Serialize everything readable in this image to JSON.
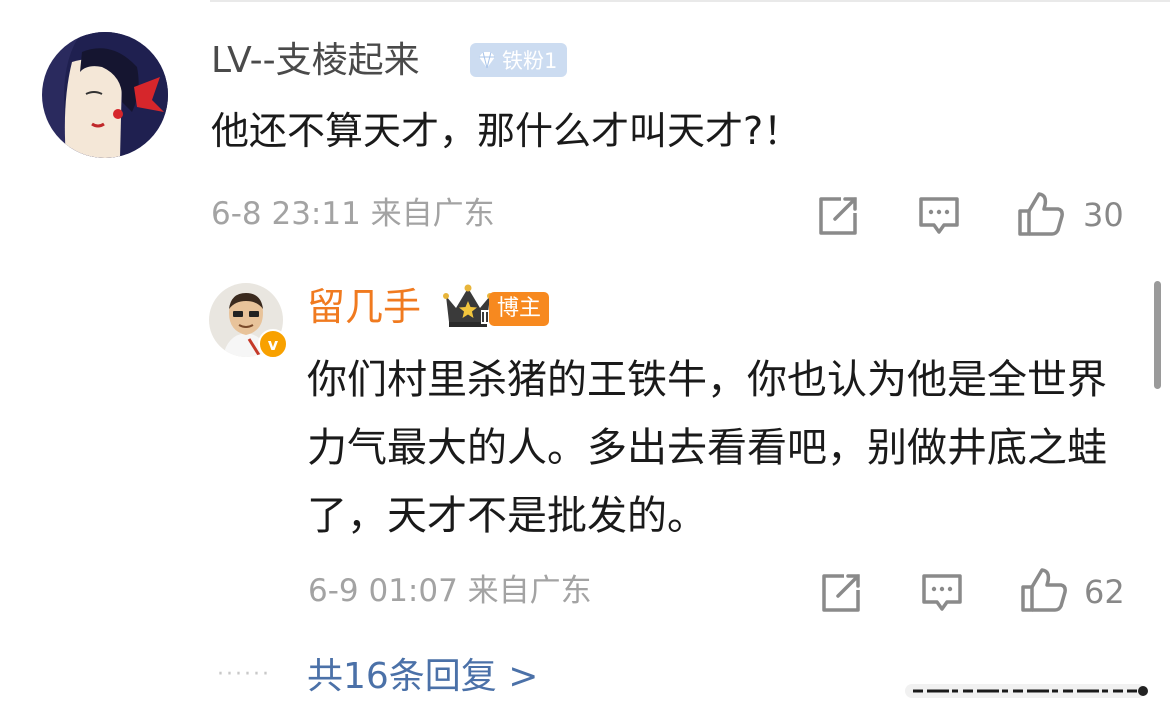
{
  "comment": {
    "username": "LV--支棱起来",
    "fan_badge": "铁粉1",
    "text": "他还不算天才，那什么才叫天才?！",
    "meta": "6-8 23:11 来自广东",
    "like_count": "30"
  },
  "reply": {
    "username": "留几手",
    "host_badge": "博主",
    "verified_mark": "v",
    "text": "你们村里杀猪的王铁牛，你也认为他是全世界力气最大的人。多出去看看吧，别做井底之蛙了，天才不是批发的。",
    "meta": "6-9 01:07 来自广东",
    "like_count": "62"
  },
  "footer": {
    "dots": "······",
    "more_replies": "共16条回复 >"
  },
  "icons": {
    "share": "share-icon",
    "comment": "comment-icon",
    "like": "thumbs-up-icon",
    "crown": "crown-icon",
    "diamond": "diamond-icon"
  },
  "colors": {
    "username": "#4a4a4a",
    "host_username": "#f07a1f",
    "fan_badge_bg": "#ccdcf1",
    "host_badge_bg": "#f7891f",
    "link": "#4b71a8",
    "meta": "#a3a3a3"
  }
}
